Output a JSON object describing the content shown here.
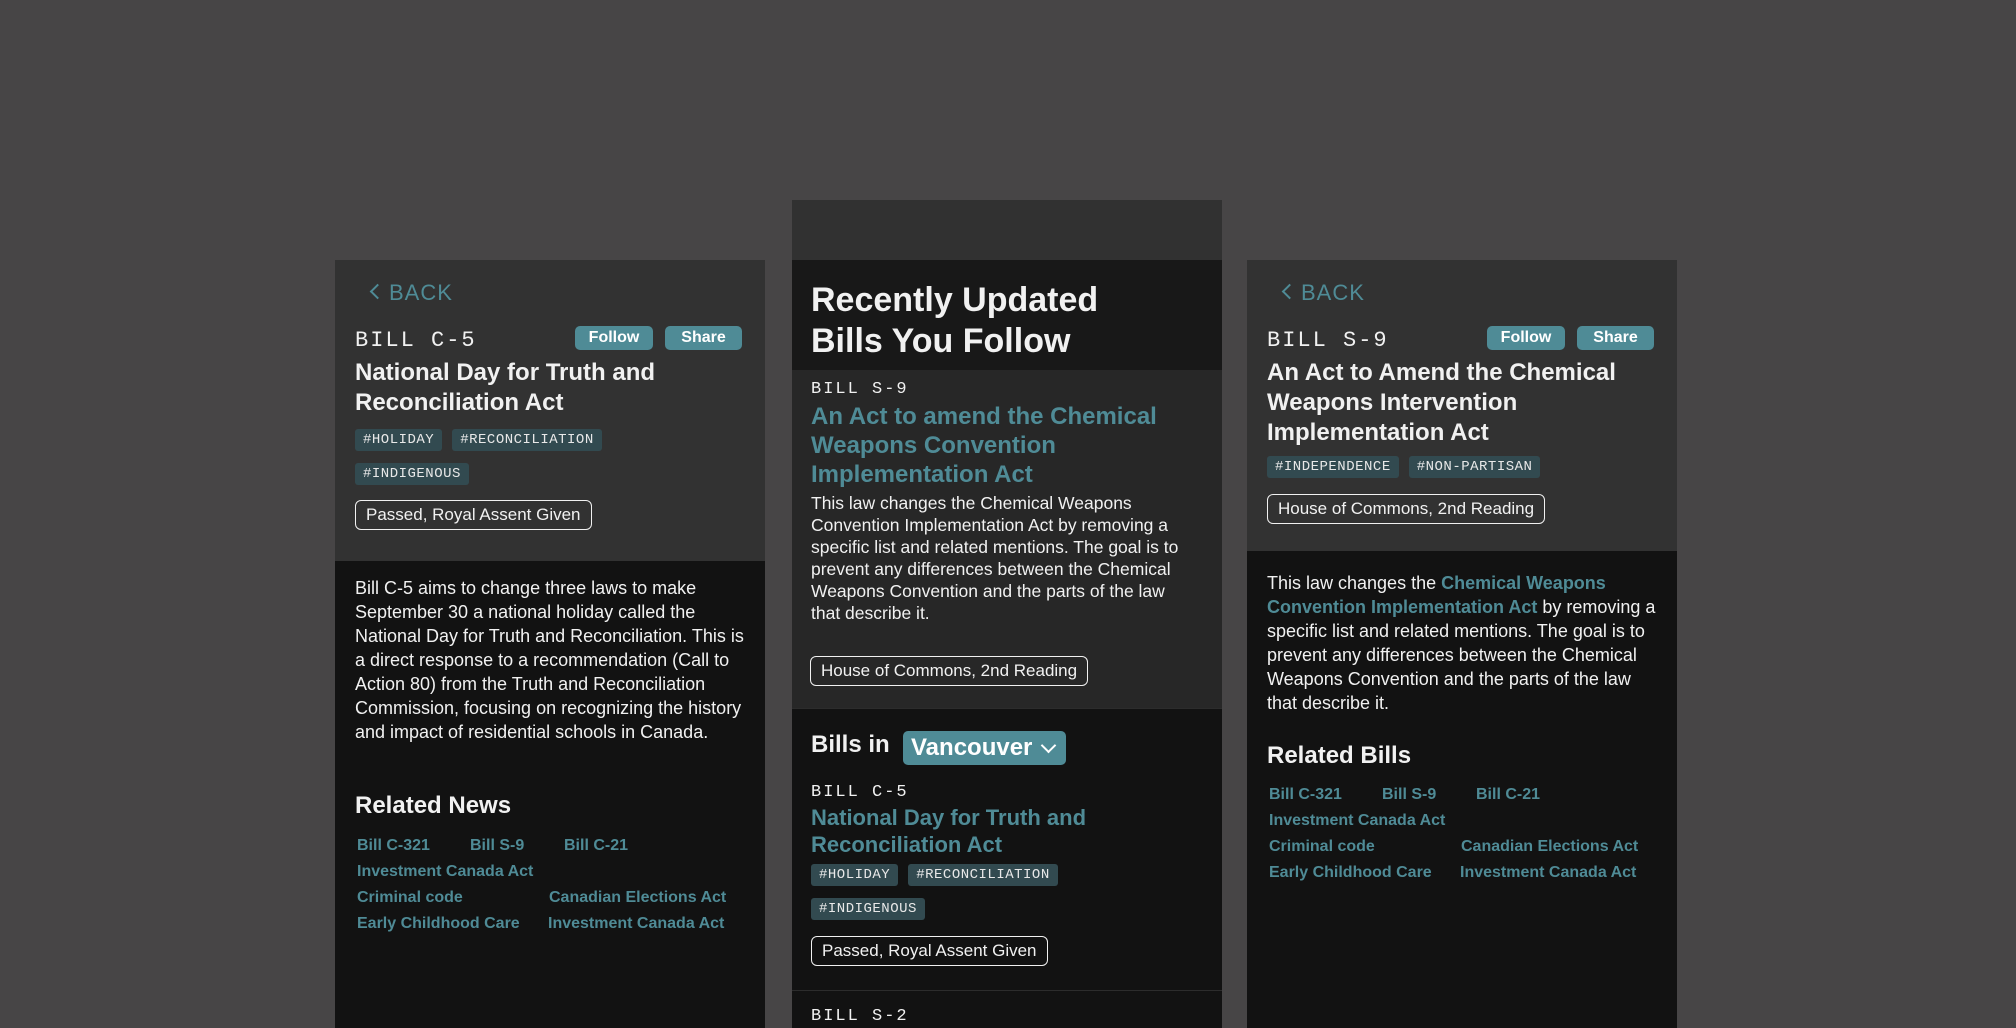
{
  "left": {
    "back": "BACK",
    "bill_code": "BILL C-5",
    "follow": "Follow",
    "share": "Share",
    "title_line1": "National Day for Truth and",
    "title_line2": "Reconciliation Act",
    "tags": [
      "#HOLIDAY",
      "#RECONCILIATION",
      "#INDIGENOUS"
    ],
    "status": "Passed, Royal Assent Given",
    "description": "Bill C-5 aims to change three laws to make September 30 a national holiday called the National Day for Truth and Reconciliation. This is a direct response to a recommendation (Call to Action 80) from the Truth and Reconciliation Commission, focusing on recognizing the history and impact of residential schools in Canada.",
    "related_heading": "Related News",
    "related": [
      "Bill C-321",
      "Bill S-9",
      "Bill C-21",
      "Investment Canada Act",
      "Criminal code",
      "Canadian Elections Act",
      "Early Childhood Care",
      "Investment Canada Act"
    ]
  },
  "middle": {
    "heading_line1": "Recently Updated",
    "heading_line2": "Bills You Follow",
    "bill1": {
      "code": "BILL S-9",
      "title_line1": "An Act to amend the Chemical",
      "title_line2": "Weapons Convention",
      "title_line3": "Implementation Act",
      "description": "This law changes the Chemical Weapons Convention Implementation Act by removing a specific list and related mentions. The goal is to prevent any differences between the Chemical Weapons Convention and the parts of the law that describe it.",
      "status": "House of Commons, 2nd Reading"
    },
    "bills_in_label": "Bills in",
    "city": "Vancouver",
    "bill2": {
      "code": "BILL C-5",
      "title_line1": "National Day for Truth and",
      "title_line2": "Reconciliation Act",
      "tags": [
        "#HOLIDAY",
        "#RECONCILIATION",
        "#INDIGENOUS"
      ],
      "status": "Passed, Royal Assent Given"
    },
    "bill3_code": "BILL S-2"
  },
  "right": {
    "back": "BACK",
    "bill_code": "BILL S-9",
    "follow": "Follow",
    "share": "Share",
    "title_line1": "An Act to Amend the Chemical",
    "title_line2": "Weapons Intervention",
    "title_line3": "Implementation Act",
    "tags": [
      "#INDEPENDENCE",
      "#NON-PARTISAN"
    ],
    "status": "House of Commons, 2nd Reading",
    "desc_pre": "This law changes the ",
    "desc_link": "Chemical Weapons Convention Implementation Act",
    "desc_post": " by removing a specific list and related mentions. The goal is to prevent any differences between the Chemical Weapons Convention and the parts of the law that describe it.",
    "related_heading": "Related Bills",
    "related": [
      "Bill C-321",
      "Bill S-9",
      "Bill C-21",
      "Investment Canada Act",
      "Criminal code",
      "Canadian Elections Act",
      "Early Childhood Care",
      "Investment Canada Act"
    ]
  },
  "colors": {
    "page_bg": "#474546",
    "panel_top": "#323232",
    "panel_body": "#121212",
    "accent": "#4f8b96",
    "tag_bg": "#324a50"
  }
}
